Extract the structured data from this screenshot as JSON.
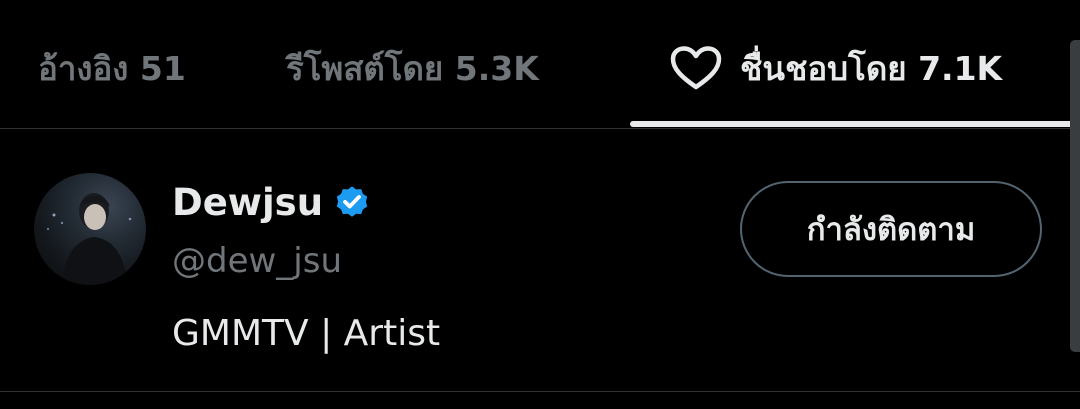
{
  "tabs": [
    {
      "label": "อ้างอิง 51",
      "active": false
    },
    {
      "label": "รีโพสต์โดย 5.3K",
      "active": false
    },
    {
      "label": "ชื่นชอบโดย 7.1K",
      "active": true,
      "icon": "heart-outline-icon"
    }
  ],
  "user": {
    "display_name": "Dewjsu",
    "verified": true,
    "verified_color": "#1d9bf0",
    "handle": "@dew_jsu",
    "bio": "GMMTV | Artist",
    "follow_button_label": "กำลังติดตาม"
  },
  "colors": {
    "background": "#000000",
    "text_primary": "#e7e9ea",
    "text_secondary": "#71767b",
    "divider": "#2f3336"
  }
}
